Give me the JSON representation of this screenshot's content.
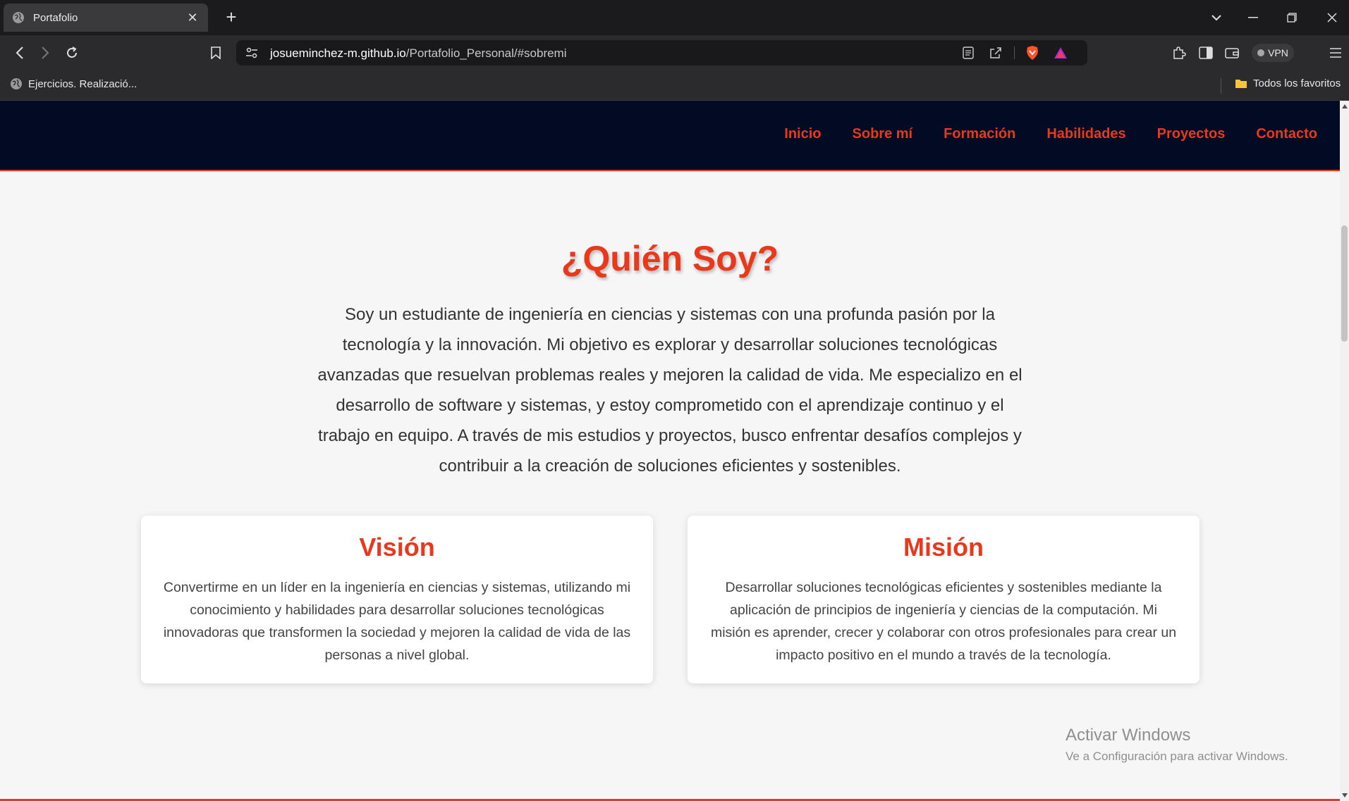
{
  "browser": {
    "tab": {
      "title": "Portafolio",
      "close_glyph": "✕"
    },
    "new_tab_glyph": "+",
    "address": {
      "host": "josueminchez-m.github.io",
      "path": "/Portafolio_Personal/#sobremi"
    },
    "vpn_label": "VPN",
    "bookmarks": {
      "item": "Ejercicios. Realizació...",
      "all_favorites": "Todos los favoritos"
    }
  },
  "nav": {
    "links": [
      "Inicio",
      "Sobre mí",
      "Formación",
      "Habilidades",
      "Proyectos",
      "Contacto"
    ]
  },
  "about": {
    "title": "¿Quién Soy?",
    "intro": "Soy un estudiante de ingeniería en ciencias y sistemas con una profunda pasión por la tecnología y la innovación. Mi objetivo es explorar y desarrollar soluciones tecnológicas avanzadas que resuelvan problemas reales y mejoren la calidad de vida. Me especializo en el desarrollo de software y sistemas, y estoy comprometido con el aprendizaje continuo y el trabajo en equipo. A través de mis estudios y proyectos, busco enfrentar desafíos complejos y contribuir a la creación de soluciones eficientes y sostenibles."
  },
  "vision": {
    "title": "Visión",
    "text": "Convertirme en un líder en la ingeniería en ciencias y sistemas, utilizando mi conocimiento y habilidades para desarrollar soluciones tecnológicas innovadoras que transformen la sociedad y mejoren la calidad de vida de las personas a nivel global."
  },
  "mission": {
    "title": "Misión",
    "text": "Desarrollar soluciones tecnológicas eficientes y sostenibles mediante la aplicación de principios de ingeniería y ciencias de la computación. Mi misión es aprender, crecer y colaborar con otros profesionales para crear un impacto positivo en el mundo a través de la tecnología."
  },
  "watermark": {
    "line1": "Activar Windows",
    "line2": "Ve a Configuración para activar Windows."
  },
  "colors": {
    "accent": "#e8391d",
    "nav_bg": "#020a24",
    "page_bg": "#f6f6f6"
  }
}
